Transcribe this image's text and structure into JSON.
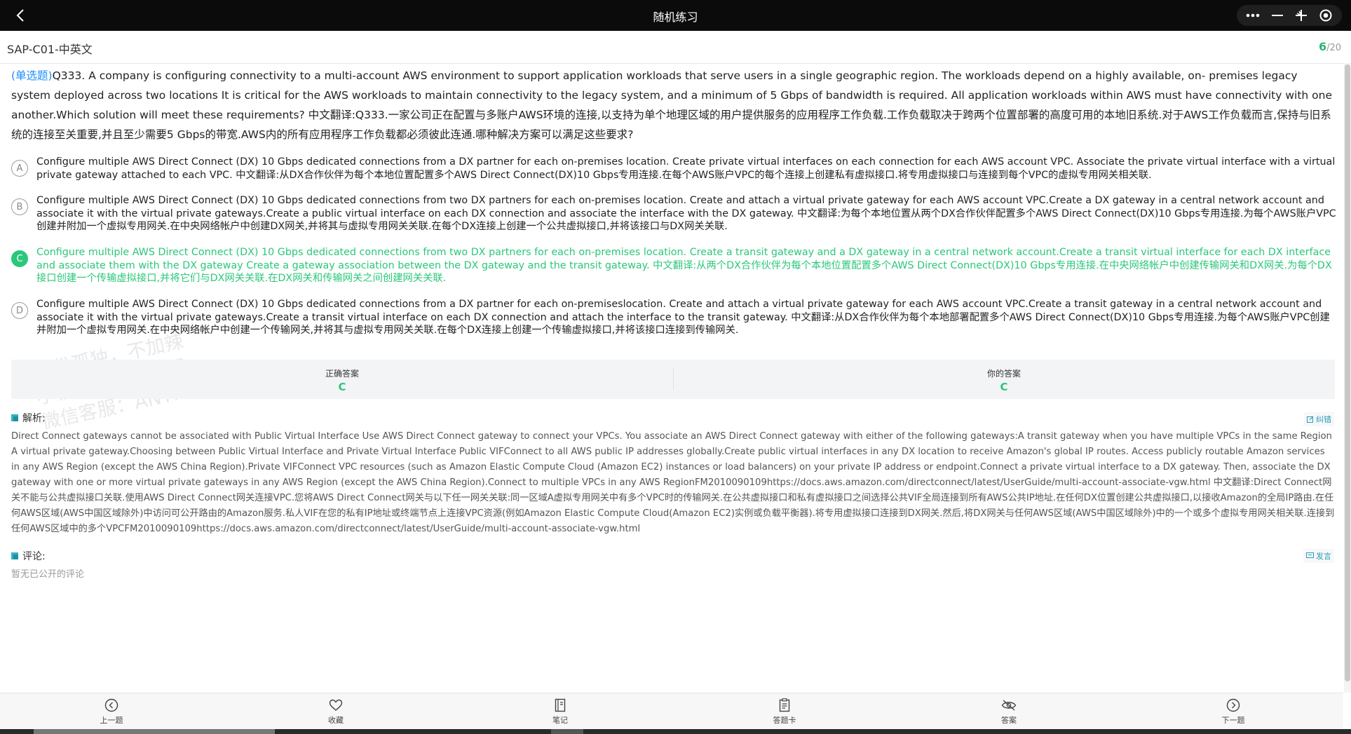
{
  "titlebar": {
    "title": "随机练习"
  },
  "header": {
    "subject": "SAP-C01-中英文",
    "current": "6",
    "total": "/20"
  },
  "question": {
    "type": "(单选题)",
    "text": "Q333. A company is configuring connectivity to a multi-account AWS environment to support application workloads that serve users in a single geographic region. The workloads depend on a highly available, on- premises legacy system deployed across two locations It is critical for the AWS workloads to maintain connectivity to the legacy system, and a minimum of 5 Gbps of bandwidth is required. All application workloads within AWS must have connectivity with one another.Which solution will meet these requirements? 中文翻译:Q333.一家公司正在配置与多账户AWS环境的连接,以支持为单个地理区域的用户提供服务的应用程序工作负载.工作负载取决于跨两个位置部署的高度可用的本地旧系统.对于AWS工作负载而言,保持与旧系统的连接至关重要,并且至少需要5 Gbps的带宽.AWS内的所有应用程序工作负载都必须彼此连通.哪种解决方案可以满足这些要求?"
  },
  "options": [
    {
      "letter": "A",
      "text": "Configure multiple AWS Direct Connect (DX) 10 Gbps dedicated connections from a DX partner for each on-premises location. Create private virtual interfaces on each connection for each AWS account VPC. Associate the private virtual interface with a virtual private gateway attached to each VPC. 中文翻译:从DX合作伙伴为每个本地位置配置多个AWS Direct Connect(DX)10 Gbps专用连接.在每个AWS账户VPC的每个连接上创建私有虚拟接口.将专用虚拟接口与连接到每个VPC的虚拟专用网关相关联."
    },
    {
      "letter": "B",
      "text": "Configure multiple AWS Direct Connect (DX) 10 Gbps dedicated connections from two DX partners for each on-premises location. Create and attach a virtual private gateway for each AWS account VPC.Create a DX gateway in a central network account and associate it with the virtual private gateways.Create a public virtual interface on each DX connection and associate the interface with the DX gateway. 中文翻译:为每个本地位置从两个DX合作伙伴配置多个AWS Direct Connect(DX)10 Gbps专用连接.为每个AWS账户VPC创建并附加一个虚拟专用网关.在中央网络帐户中创建DX网关,并将其与虚拟专用网关关联.在每个DX连接上创建一个公共虚拟接口,并将该接口与DX网关关联."
    },
    {
      "letter": "C",
      "text": "Configure multiple AWS Direct Connect (DX) 10 Gbps dedicated connections from two DX partners for each on-premises location. Create a transit gateway and a DX gateway in a central network account.Create a transit virtual interface for each DX interface and associate them with the DX gateway Create a gateway association between the DX gateway and the transit gateway. 中文翻译:从两个DX合作伙伴为每个本地位置配置多个AWS Direct Connect(DX)10 Gbps专用连接.在中央网络帐户中创建传输网关和DX网关.为每个DX接口创建一个传输虚拟接口,并将它们与DX网关关联.在DX网关和传输网关之间创建网关关联."
    },
    {
      "letter": "D",
      "text": "Configure multiple AWS Direct Connect (DX) 10 Gbps dedicated connections from a DX partner for each on-premiseslocation. Create and attach a virtual private gateway for each AWS account VPC.Create a transit gateway in a central network account and associate it with the virtual private gateways.Create a transit virtual interface on each DX connection and attach the interface to the transit gateway. 中文翻译:从DX合作伙伴为每个本地部署配置多个AWS Direct Connect(DX)10 Gbps专用连接.为每个AWS账户VPC创建并附加一个虚拟专用网关.在中央网络帐户中创建一个传输网关,并将其与虚拟专用网关关联.在每个DX连接上创建一个传输虚拟接口,并将该接口连接到传输网关."
    }
  ],
  "answers": {
    "correct_label": "正确答案",
    "correct_value": "C",
    "yours_label": "你的答案",
    "yours_value": "C"
  },
  "analysis": {
    "title": "解析:",
    "action": "纠错",
    "text": "Direct Connect gateways cannot be associated with Public Virtual Interface Use AWS Direct Connect gateway to connect your VPCs. You associate an AWS Direct Connect gateway with either of the following gateways:A transit gateway when you have multiple VPCs in the same Region A virtual private gateway.Choosing between Public Virtual Interface and Private Virtual Interface Public VIFConnect to all AWS public IP addresses globally.Create public virtual interfaces in any DX location to receive Amazon's global IP routes. Access publicly routable Amazon services in any AWS Region (except the AWS China Region).Private VIFConnect VPC resources (such as Amazon Elastic Compute Cloud (Amazon EC2) instances or load balancers) on your private IP address or endpoint.Connect a private virtual interface to a DX gateway. Then, associate the DX gateway with one or more virtual private gateways in any AWS Region (except the AWS China Region).Connect to multiple VPCs in any AWS RegionFM2010090109https://docs.aws.amazon.com/directconnect/latest/UserGuide/multi-account-associate-vgw.html 中文翻译:Direct Connect网关不能与公共虚拟接口关联.使用AWS Direct Connect网关连接VPC.您将AWS Direct Connect网关与以下任一网关关联:同一区域A虚拟专用网关中有多个VPC时的传输网关.在公共虚拟接口和私有虚拟接口之间选择公共VIF全局连接到所有AWS公共IP地址.在任何DX位置创建公共虚拟接口,以接收Amazon的全局IP路由.在任何AWS区域(AWS中国区域除外)中访问可公开路由的Amazon服务.私人VIF在您的私有IP地址或终端节点上连接VPC资源(例如Amazon Elastic Compute Cloud(Amazon EC2)实例或负载平衡器).将专用虚拟接口连接到DX网关.然后,将DX网关与任何AWS区域(AWS中国区域除外)中的一个或多个虚拟专用网关相关联.连接到任何AWS区域中的多个VPCFM2010090109https://docs.aws.amazon.com/directconnect/latest/UserGuide/multi-account-associate-vgw.html"
  },
  "comments": {
    "title": "评论:",
    "action": "发言",
    "empty": "暂无已公开的评论"
  },
  "watermark": {
    "line1": "来一份孤独，不加辣",
    "line2": "小程序：微考大师",
    "line3": "微信客服：ANYPASS"
  },
  "bottom_nav": [
    {
      "label": "上一题",
      "icon": "prev-circle-icon"
    },
    {
      "label": "收藏",
      "icon": "heart-icon"
    },
    {
      "label": "笔记",
      "icon": "notebook-icon"
    },
    {
      "label": "答题卡",
      "icon": "answer-card-icon"
    },
    {
      "label": "答案",
      "icon": "eye-hidden-icon"
    },
    {
      "label": "下一题",
      "icon": "next-circle-icon"
    }
  ],
  "colors": {
    "accent_green": "#2bc77a",
    "question_type_blue": "#1a8cff",
    "titlebar_bg": "#0b0b0b"
  }
}
